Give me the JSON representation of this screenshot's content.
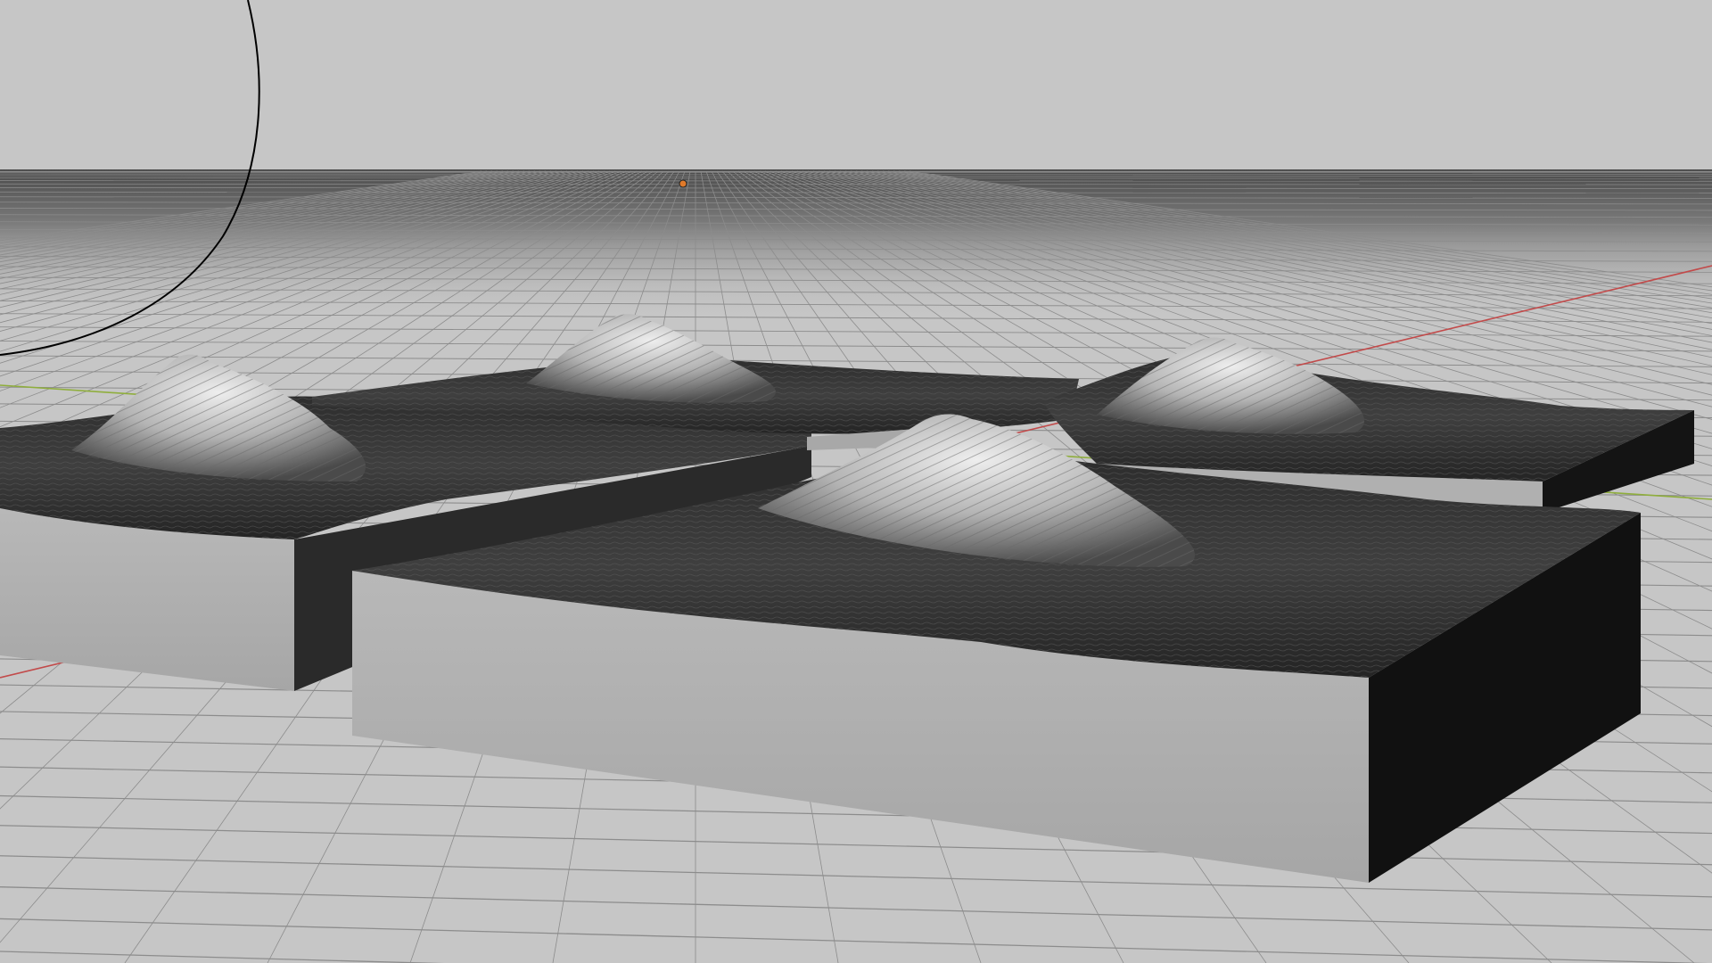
{
  "viewport": {
    "kind": "3d-viewport",
    "shading": "solid",
    "background_color": "#c6c6c6",
    "grid_color": "#8c8c8c",
    "axis_x_color": "#c24a4a",
    "axis_y_color": "#8fae3c"
  },
  "objects": [
    {
      "name": "terrain-tile-back-left",
      "type": "mesh",
      "peak_count": 1
    },
    {
      "name": "terrain-tile-back-center",
      "type": "mesh",
      "peak_count": 1
    },
    {
      "name": "terrain-tile-back-right",
      "type": "mesh",
      "peak_count": 1
    },
    {
      "name": "terrain-tile-front",
      "type": "mesh",
      "peak_count": 1
    },
    {
      "name": "light-origin",
      "type": "light"
    },
    {
      "name": "selection-circle",
      "type": "gizmo"
    }
  ],
  "icons": {
    "light": "light-origin-icon",
    "circle": "view-circle-icon"
  }
}
